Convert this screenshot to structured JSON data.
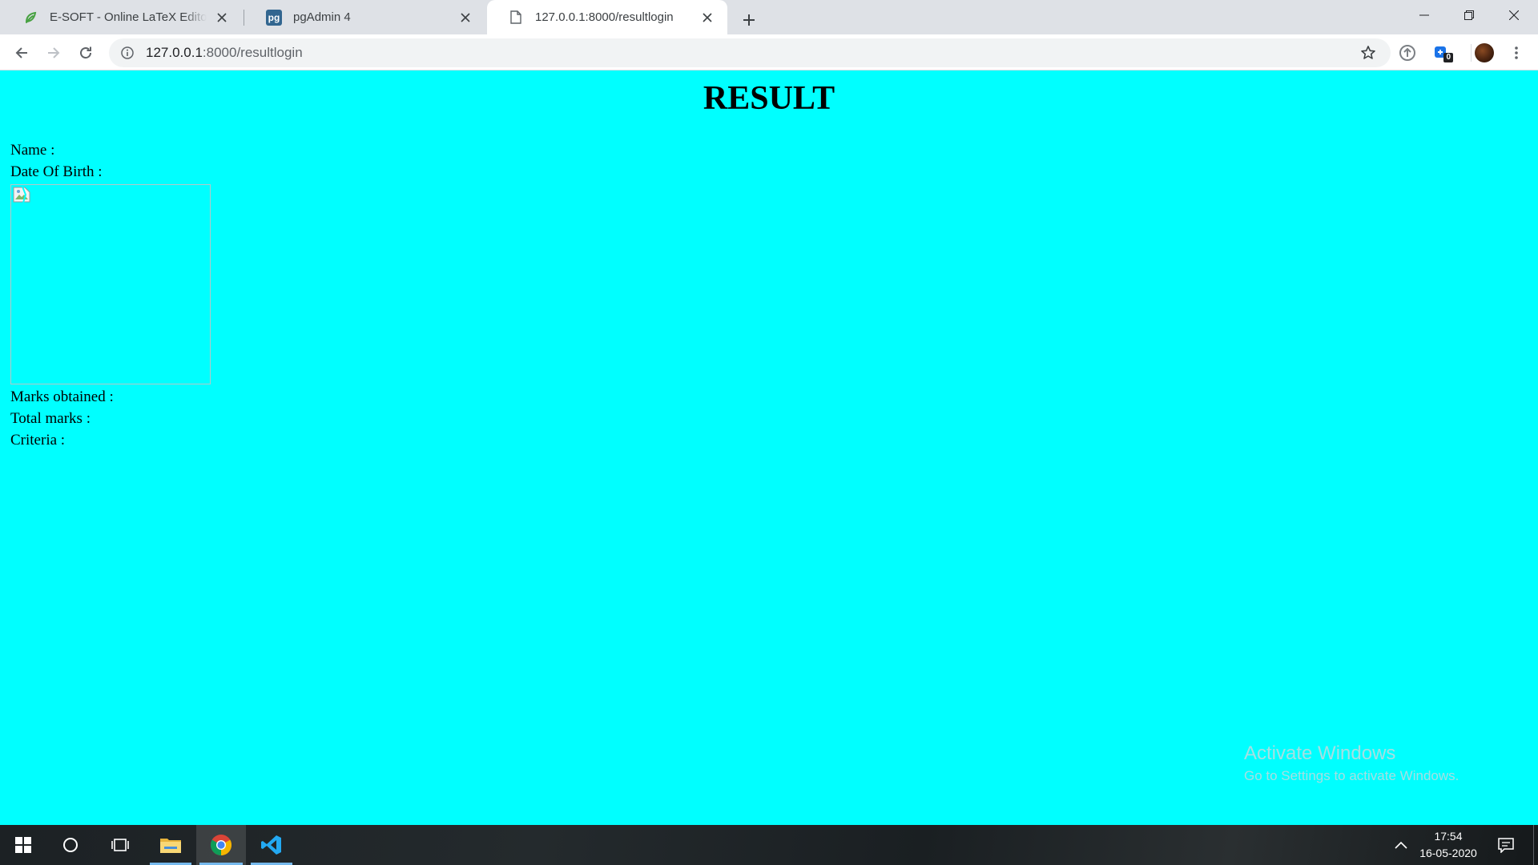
{
  "browser": {
    "tabs": [
      {
        "title": "E-SOFT - Online LaTeX Editor Ov",
        "icon": "overleaf-leaf-icon",
        "active": false
      },
      {
        "title": "pgAdmin 4",
        "icon": "pgadmin-icon",
        "active": false
      },
      {
        "title": "127.0.0.1:8000/resultlogin",
        "icon": "page-icon",
        "active": true
      }
    ],
    "url_host": "127.0.0.1",
    "url_path": ":8000/resultlogin",
    "extension_badge": "0",
    "pgadmin_logo_text": "pg"
  },
  "page": {
    "title": "RESULT",
    "background": "#00ffff",
    "fields": {
      "name_label": "Name :",
      "dob_label": "Date Of Birth :",
      "marks_obtained_label": "Marks obtained :",
      "total_marks_label": "Total marks :",
      "criteria_label": "Criteria :"
    }
  },
  "watermark": {
    "line1": "Activate Windows",
    "line2": "Go to Settings to activate Windows."
  },
  "taskbar": {
    "time": "17:54",
    "date": "16-05-2020",
    "accent": "#76b9ed"
  }
}
